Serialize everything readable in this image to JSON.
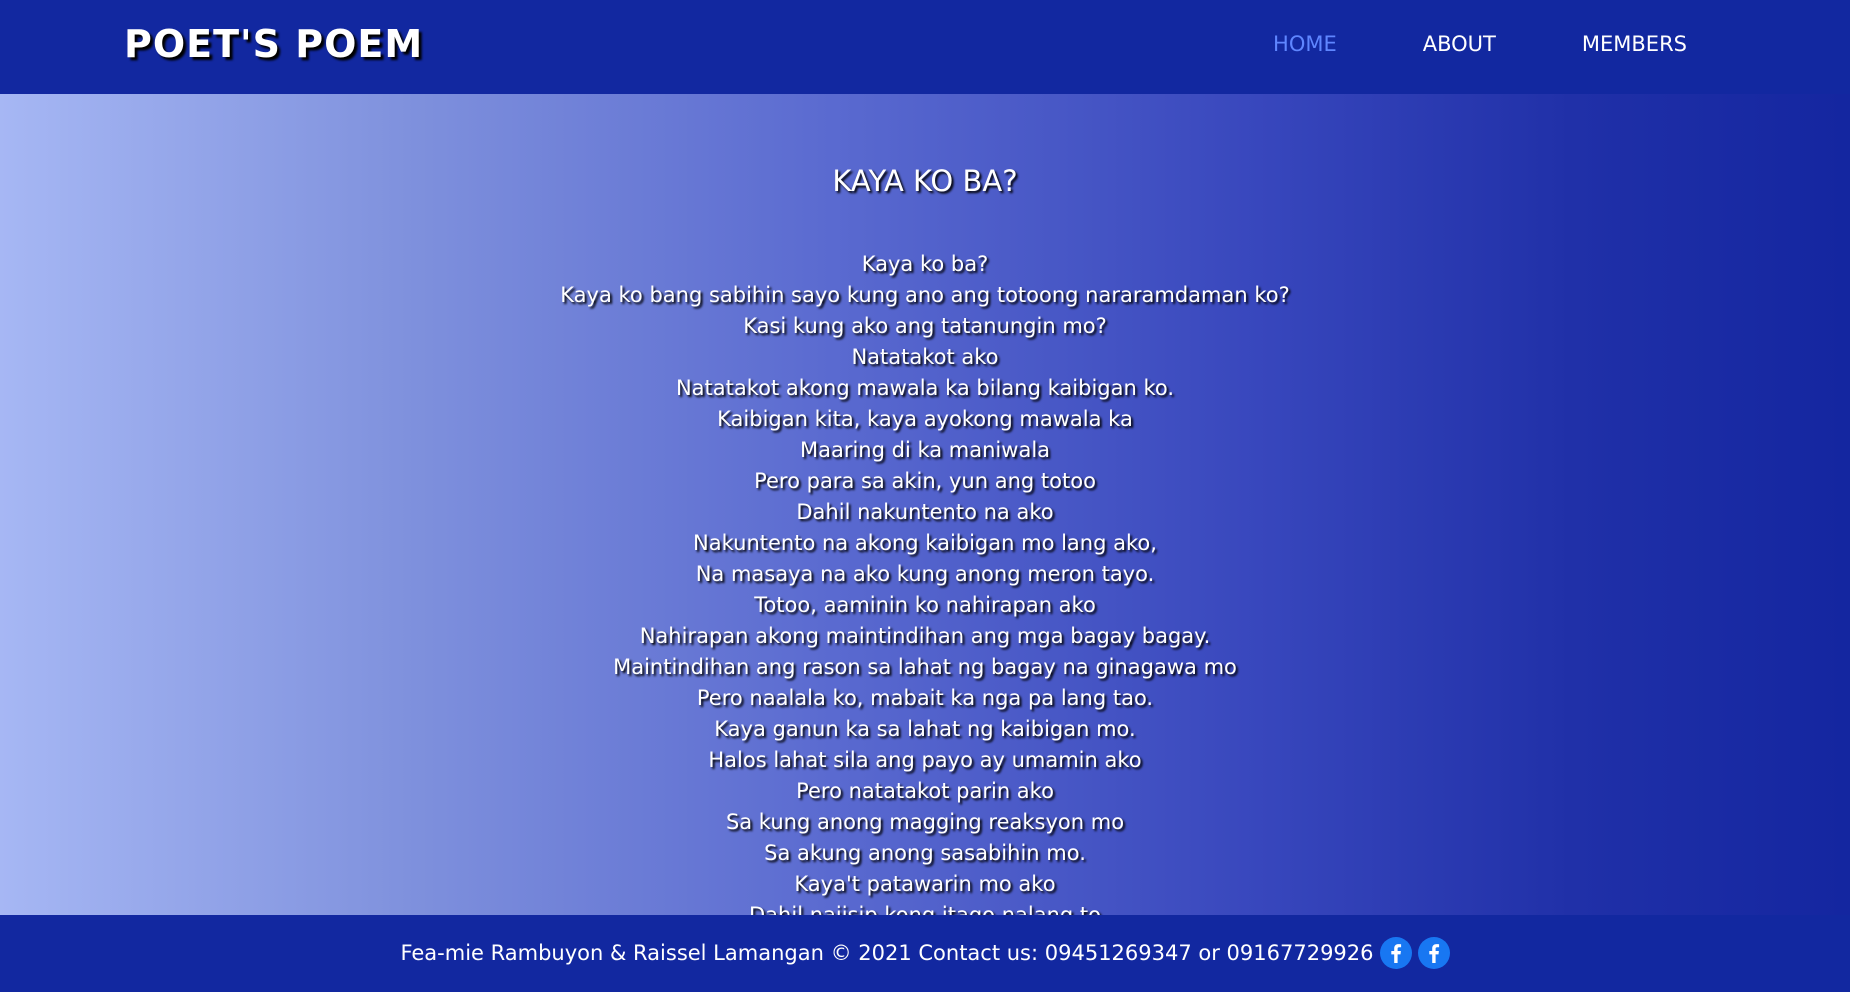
{
  "header": {
    "brand": "POET'S POEM",
    "nav": [
      {
        "label": "HOME"
      },
      {
        "label": "ABOUT"
      },
      {
        "label": "MEMBERS"
      }
    ]
  },
  "main": {
    "title": "KAYA KO BA?",
    "lines": [
      "Kaya ko ba?",
      "Kaya ko bang sabihin sayo kung ano ang totoong nararamdaman ko?",
      "Kasi kung ako ang tatanungin mo?",
      "Natatakot ako",
      "Natatakot akong mawala ka bilang kaibigan ko.",
      "Kaibigan kita, kaya ayokong mawala ka",
      "Maaring di ka maniwala",
      "Pero para sa akin, yun ang totoo",
      "Dahil nakuntento na ako",
      "Nakuntento na akong kaibigan mo lang ako,",
      "Na masaya na ako kung anong meron tayo.",
      "Totoo, aaminin ko nahirapan ako",
      "Nahirapan akong maintindihan ang mga bagay bagay.",
      "Maintindihan ang rason sa lahat ng bagay na ginagawa mo",
      "Pero naalala ko, mabait ka nga pa lang tao.",
      "Kaya ganun ka sa lahat ng kaibigan mo.",
      "Halos lahat sila ang payo ay umamin ako",
      "Pero natatakot parin ako",
      "Sa kung anong magging reaksyon mo",
      "Sa akung anong sasabihin mo.",
      "Kaya't patawarin mo ako",
      "Dahil naiisip kong itago nalang to"
    ]
  },
  "footer": {
    "text": "Fea-mie Rambuyon & Raissel Lamangan © 2021 Contact us: 09451269347 or 09167729926",
    "icons": [
      "facebook-icon",
      "facebook-icon"
    ]
  },
  "colors": {
    "header_bg": "#1228a0",
    "active_nav": "#5f86ff",
    "facebook_blue": "#1877f2"
  }
}
